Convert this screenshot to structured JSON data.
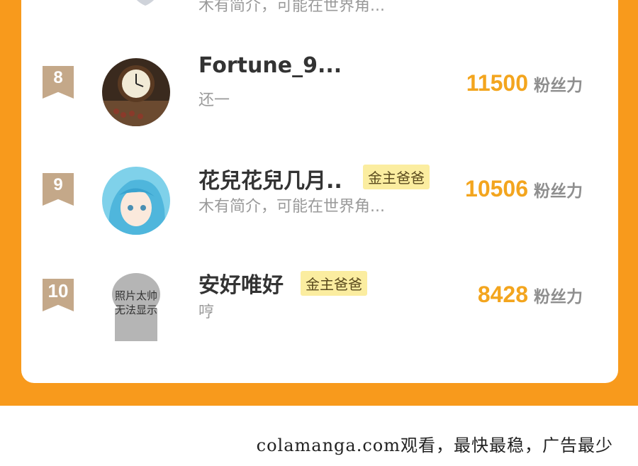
{
  "ranking": {
    "previous_row": {
      "description": "木有简介，可能在世界角..."
    },
    "rows": [
      {
        "rank": "8",
        "name": "Fortune_9...",
        "badge": "",
        "description": "还一",
        "score": "11500",
        "score_unit": "粉丝力",
        "avatar": "clock-avatar"
      },
      {
        "rank": "9",
        "name": "花兒花兒几月..",
        "badge": "金主爸爸",
        "description": "木有简介，可能在世界角...",
        "score": "10506",
        "score_unit": "粉丝力",
        "avatar": "anime-girl-avatar"
      },
      {
        "rank": "10",
        "name": "安好唯好",
        "badge": "金主爸爸",
        "description": "哼",
        "score": "8428",
        "score_unit": "粉丝力",
        "avatar": "placeholder-avatar",
        "avatar_placeholder_line1": "照片太帅",
        "avatar_placeholder_line2": "无法显示"
      }
    ]
  },
  "footer": {
    "watermark": "colamanga.com观看，最快最稳，广告最少"
  },
  "colors": {
    "accent_orange": "#f89a1c",
    "score_color": "#f3a51e",
    "rank_ribbon": "#c4a889",
    "badge_bg": "#fbeda0"
  }
}
